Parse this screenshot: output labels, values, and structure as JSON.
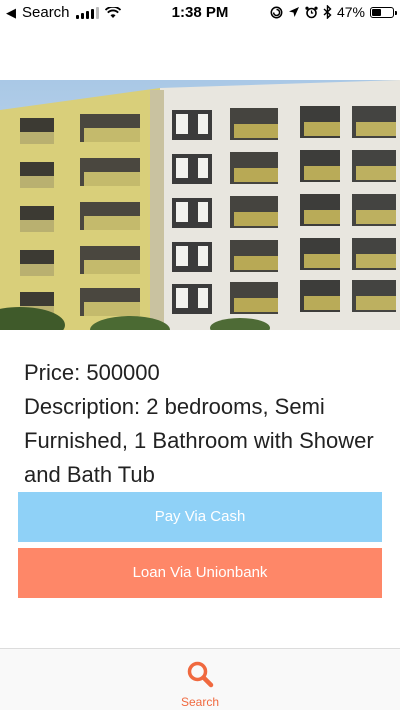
{
  "status_bar": {
    "back_label": "Search",
    "time": "1:38 PM",
    "battery_percent": "47%",
    "battery_level": 0.47,
    "icons": [
      "signal-icon",
      "wifi-icon",
      "location-lock-icon",
      "location-arrow-icon",
      "alarm-icon",
      "bluetooth-icon",
      "battery-icon"
    ]
  },
  "listing": {
    "image": "apartment-building-photo",
    "price": "Price: 500000",
    "description": "Description: 2 bedrooms, Semi Furnished, 1 Bathroom with Shower and Bath Tub"
  },
  "actions": {
    "cash_label": "Pay Via Cash",
    "loan_label": "Loan Via Unionbank",
    "cash_color": "#8fd1f7",
    "loan_color": "#fe8768"
  },
  "tab_bar": {
    "search_label": "Search",
    "search_icon": "search-icon",
    "active_color": "#f0693f"
  }
}
